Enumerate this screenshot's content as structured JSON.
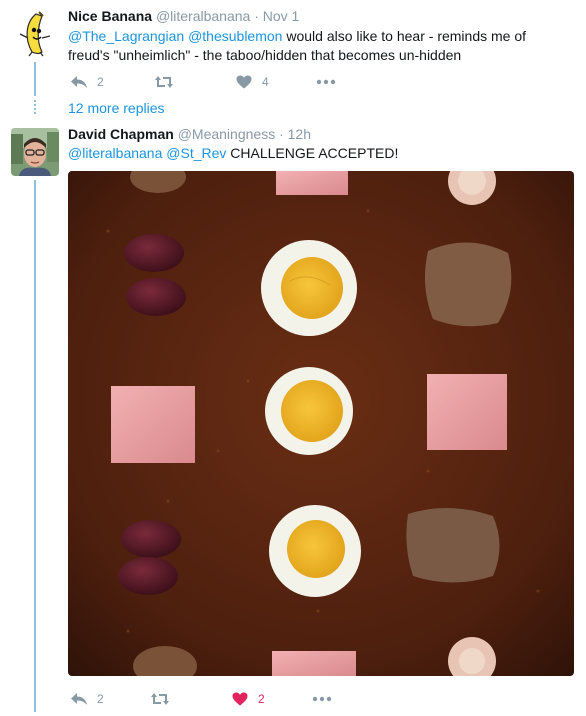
{
  "tweets": [
    {
      "name": "Nice Banana",
      "handle": "@literalbanana",
      "time": "· Nov 1",
      "mention_1": "@The_Lagrangian",
      "mention_2": "@thesublemon",
      "text_line1": " would also like to hear - reminds me of",
      "text_line2": "freud's \"unheimlich\" - the taboo/hidden that becomes un-hidden",
      "replies": "2",
      "retweets": "",
      "likes": "4"
    },
    {
      "name": "David Chapman",
      "handle": "@Meaningness",
      "time": "· 12h",
      "mention_1": "@literalbanana",
      "mention_2": "@St_Rev",
      "text": " CHALLENGE ACCEPTED!",
      "replies": "2",
      "retweets": "",
      "likes": "2"
    }
  ],
  "more_replies": "12 more replies",
  "icons": {
    "reply": "reply-icon",
    "retweet": "retweet-icon",
    "like": "heart-icon",
    "more": "more-dots-icon"
  },
  "colors": {
    "link": "#1b95e0",
    "thread_line": "#8ec1dc",
    "liked": "#e0245e",
    "muted": "#8899a6"
  }
}
